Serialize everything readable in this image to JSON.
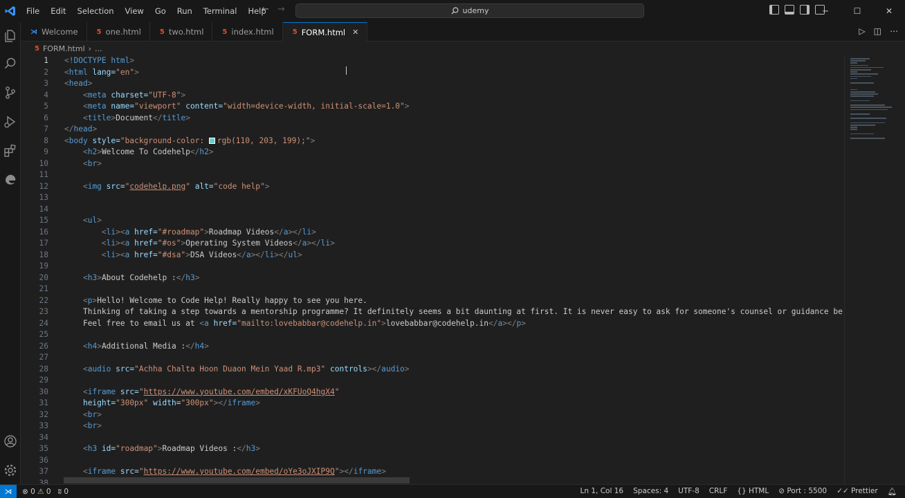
{
  "menu": [
    "File",
    "Edit",
    "Selection",
    "View",
    "Go",
    "Run",
    "Terminal",
    "Help"
  ],
  "search": {
    "text": "udemy"
  },
  "tabs": [
    {
      "label": "Welcome",
      "icon": "vscode-icon"
    },
    {
      "label": "one.html",
      "icon": "html5-icon"
    },
    {
      "label": "two.html",
      "icon": "html5-icon"
    },
    {
      "label": "index.html",
      "icon": "html5-icon"
    },
    {
      "label": "FORM.html",
      "icon": "html5-icon",
      "active": true
    }
  ],
  "breadcrumb": {
    "file": "FORM.html",
    "rest": "..."
  },
  "editor": {
    "current_line": 1,
    "lines": [
      {
        "n": "1"
      },
      {
        "n": "2"
      },
      {
        "n": "3"
      },
      {
        "n": "4"
      },
      {
        "n": "5"
      },
      {
        "n": "6"
      },
      {
        "n": "7"
      },
      {
        "n": "8"
      },
      {
        "n": "9"
      },
      {
        "n": "10"
      },
      {
        "n": "11"
      },
      {
        "n": "12"
      },
      {
        "n": "13"
      },
      {
        "n": "14"
      },
      {
        "n": "15"
      },
      {
        "n": "16"
      },
      {
        "n": "17"
      },
      {
        "n": "18"
      },
      {
        "n": "19"
      },
      {
        "n": "20"
      },
      {
        "n": "21"
      },
      {
        "n": "22"
      },
      {
        "n": "23"
      },
      {
        "n": "24"
      },
      {
        "n": "25"
      },
      {
        "n": "26"
      },
      {
        "n": "27"
      },
      {
        "n": "28"
      },
      {
        "n": "29"
      },
      {
        "n": "30"
      },
      {
        "n": "31"
      },
      {
        "n": "32"
      },
      {
        "n": "33"
      },
      {
        "n": "34"
      },
      {
        "n": "35"
      },
      {
        "n": "36"
      },
      {
        "n": "37"
      },
      {
        "n": "38"
      }
    ],
    "code": {
      "l1": "!DOCTYPE html",
      "l2_attr": "lang=",
      "l2_val": "\"en\"",
      "l4_attr": "charset=",
      "l4_val": "\"UTF-8\"",
      "l5_a1": "name=",
      "l5_v1": "\"viewport\"",
      "l5_a2": "content=",
      "l5_v2": "\"width=device-width, initial-scale=1.0\"",
      "l6_text": "Document",
      "l8_attr": "style=",
      "l8_val1": "\"background-color: ",
      "l8_val2": "rgb(110, 203, 199);\"",
      "l9_text": "Welcome To Codehelp",
      "l12_a1": "src=",
      "l12_v1q": "\"",
      "l12_v1": "codehelp.png",
      "l12_v1e": "\"",
      "l12_a2": "alt=",
      "l12_v2": "\"code help\"",
      "l16_a": "href=",
      "l16_v": "\"#roadmap\"",
      "l16_t": "Roadmap Videos",
      "l17_a": "href=",
      "l17_v": "\"#os\"",
      "l17_t": "Operating System Videos",
      "l18_a": "href=",
      "l18_v": "\"#dsa\"",
      "l18_t": "DSA Videos",
      "l20_t": "About Codehelp :",
      "l22_t": "Hello! Welcome to Code Help! Really happy to see you here.",
      "l23_t": "Thinking of taking a step towards a mentorship programme? It definitely seems a bit daunting at first. It is never easy to ask for someone's counsel or guidance be it f",
      "l24_t1": "Feel free to email us at ",
      "l24_a": "href=",
      "l24_v": "\"mailto:lovebabbar@codehelp.in\"",
      "l24_t2": "lovebabbar@codehelp.in",
      "l26_t": "Additional Media :",
      "l28_a": "src=",
      "l28_v": "\"Achha Chalta Hoon Duaon Mein Yaad R.mp3\"",
      "l28_a2": "controls",
      "l30_a": "src=",
      "l30_q": "\"",
      "l30_v": "https://www.youtube.com/embed/xKFUoQ4hgX4",
      "l30_e": "\"",
      "l31_a1": "height=",
      "l31_v1": "\"300px\"",
      "l31_a2": "width=",
      "l31_v2": "\"300px\"",
      "l35_a": "id=",
      "l35_v": "\"roadmap\"",
      "l35_t": "Roadmap Videos :",
      "l37_a": "src=",
      "l37_q": "\"",
      "l37_v": "https://www.youtube.com/embed/oYe3oJXIP9Q",
      "l37_e": "\""
    }
  },
  "status": {
    "errors": "0",
    "warnings": "0",
    "ports": "0",
    "position": "Ln 1, Col 16",
    "spaces": "Spaces: 4",
    "encoding": "UTF-8",
    "eol": "CRLF",
    "language": "HTML",
    "port": "Port : 5500",
    "prettier": "Prettier"
  },
  "colors": {
    "accent": "#0078d4",
    "swatch": "#6ecbc7",
    "html_icon": "#e44d26"
  }
}
